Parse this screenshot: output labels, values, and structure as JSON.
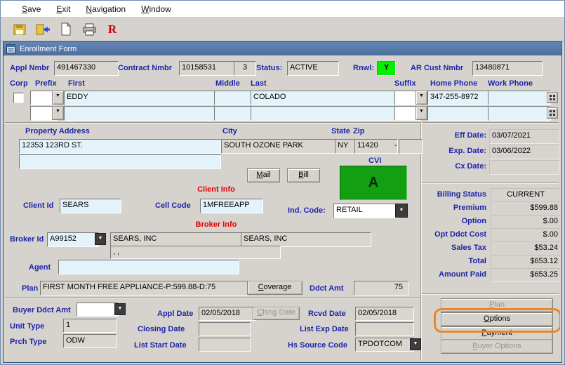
{
  "menu": {
    "save": "Save",
    "exit": "Exit",
    "navigation": "Navigation",
    "window": "Window"
  },
  "toolbar": {
    "r_button": "R"
  },
  "titlebar": {
    "title": "Enrollment Form"
  },
  "header": {
    "appl_nmbr_label": "Appl Nmbr",
    "appl_nmbr": "491467330",
    "contract_nmbr_label": "Contract Nmbr",
    "contract_nmbr": "10158531",
    "contract_seq": "3",
    "status_label": "Status:",
    "status": "ACTIVE",
    "rnwl_label": "Rnwl:",
    "rnwl": "Y",
    "ar_cust_label": "AR Cust Nmbr",
    "ar_cust_nmbr": "13480871"
  },
  "name": {
    "corp_label": "Corp",
    "prefix_label": "Prefix",
    "first_label": "First",
    "middle_label": "Middle",
    "last_label": "Last",
    "suffix_label": "Suffix",
    "home_phone_label": "Home Phone",
    "work_phone_label": "Work Phone",
    "first": "EDDY",
    "last": "COLADO",
    "home_phone": "347-255-8972"
  },
  "address": {
    "property_label": "Property Address",
    "city_label": "City",
    "state_label": "State",
    "zip_label": "Zip",
    "line1": "12353 123RD ST.",
    "line2": "",
    "city": "SOUTH OZONE PARK",
    "state": "NY",
    "zip": "11420",
    "zip_separator": "-",
    "zip4": "",
    "mail_button": "Mail",
    "bill_button": "Bill",
    "cvi_label": "CVI",
    "cvi_value": "A"
  },
  "dates": {
    "eff_label": "Eff Date:",
    "eff": "03/07/2021",
    "exp_label": "Exp. Date:",
    "exp": "03/06/2022",
    "cx_label": "Cx Date:",
    "cx": ""
  },
  "client": {
    "section": "Client Info",
    "client_id_label": "Client Id",
    "client_id": "SEARS",
    "cell_code_label": "Cell Code",
    "cell_code": "1MFREEAPP",
    "ind_code_label": "Ind. Code:",
    "ind_code": "RETAIL"
  },
  "billing": {
    "rows": [
      {
        "label": "Billing Status",
        "value": "CURRENT"
      },
      {
        "label": "Premium",
        "value": "$599.88"
      },
      {
        "label": "Option",
        "value": "$.00"
      },
      {
        "label": "Opt Ddct Cost",
        "value": "$.00"
      },
      {
        "label": "Sales Tax",
        "value": "$53.24"
      },
      {
        "label": "Total",
        "value": "$653.12"
      },
      {
        "label": "Amount Paid",
        "value": "$653.25"
      }
    ]
  },
  "broker": {
    "section": "Broker Info",
    "broker_id_label": "Broker Id",
    "broker_id": "A99152",
    "name1": "SEARS, INC",
    "name2": "SEARS, INC",
    "address": ", ,",
    "agent_label": "Agent",
    "agent": ""
  },
  "plan": {
    "plan_label": "Plan",
    "plan": "FIRST MONTH FREE APPLIANCE-P:599.88-D:75",
    "coverage_button": "Coverage",
    "ddct_amt_label": "Ddct Amt",
    "ddct_amt": "75",
    "buyer_ddct_label": "Buyer Ddct Amt",
    "buyer_ddct": "",
    "appl_date_label": "Appl Date",
    "appl_date": "02/05/2018",
    "clsng_date_button": "Clsng Date",
    "rcvd_date_label": "Rcvd Date",
    "rcvd_date": "02/05/2018",
    "unit_type_label": "Unit Type",
    "unit_type": "1",
    "closing_date_label": "Closing Date",
    "closing_date": "",
    "list_exp_label": "List Exp Date",
    "list_exp": "",
    "prch_type_label": "Prch Type",
    "prch_type": "ODW",
    "list_start_label": "List Start Date",
    "list_start": "",
    "hs_source_label": "Hs Source Code",
    "hs_source": "TPDOTCOM"
  },
  "actions": {
    "plan": "Plan",
    "options": "Options",
    "payment": "Payment",
    "buyer_options": "Buyer Options"
  },
  "colors": {
    "title_blue": "#4d6f9e",
    "label_blue": "#1c25a8",
    "section_red": "#e60000",
    "field_cyan": "#e3f3fa",
    "rnwl_green": "#00f000",
    "cvi_green": "#12a012",
    "highlight_orange": "#e8872b"
  }
}
